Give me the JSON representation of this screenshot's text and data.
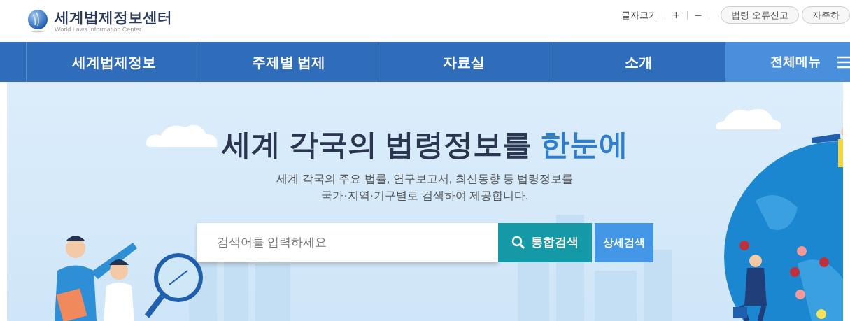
{
  "logo": {
    "title": "세계법제정보센터",
    "subtitle": "World Laws Information Center"
  },
  "utility": {
    "font_size_label": "글자크기",
    "increase": "+",
    "decrease": "−",
    "links": [
      "법령 오류신고",
      "자주하"
    ]
  },
  "nav": {
    "items": [
      {
        "label": "세계법제정보",
        "kind": "menu"
      },
      {
        "label": "주제별 법제",
        "kind": "menu"
      },
      {
        "label": "자료실",
        "kind": "menu"
      },
      {
        "label": "소개",
        "kind": "menu"
      },
      {
        "label": "전체메뉴",
        "kind": "all"
      }
    ]
  },
  "hero": {
    "title": "세계 각국의 법령정보를",
    "title_highlight": "한눈에",
    "description": [
      "세계 각국의 주요 법률, 연구보고서, 최신동향 등 법령정보를",
      "국가·지역·기구별로 검색하여 제공합니다."
    ]
  },
  "search": {
    "placeholder": "검색어를 입력하세요",
    "buttons": [
      {
        "label": "통합검색",
        "kind": "primary"
      },
      {
        "label": "상세검색",
        "kind": "secondary"
      }
    ]
  }
}
